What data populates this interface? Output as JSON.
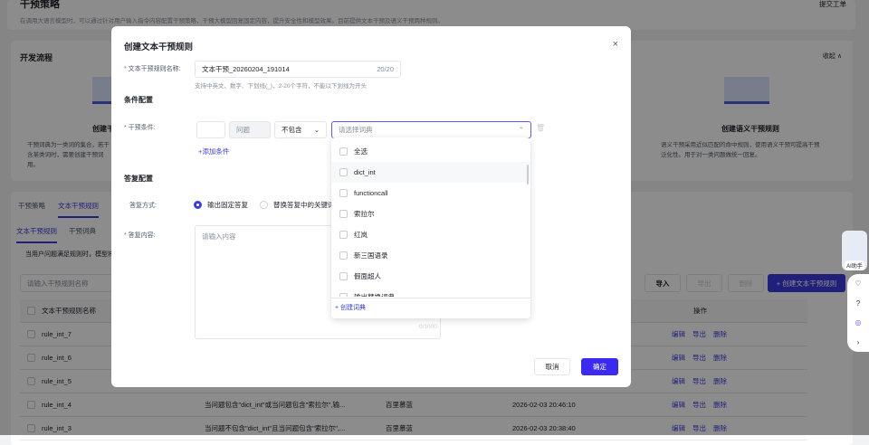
{
  "page": {
    "title": "干预策略",
    "ticket": "提交工单",
    "description": "在调用大语言模型时，可以通过针对用户输入指令内容配置干预策略，干预大模型回复固定内容，提升安全性和模型效果。目前提供文本干预及语义干预两种规则。"
  },
  "flow": {
    "title": "开发流程",
    "collapse": "收起 ∧",
    "left_title": "创建干",
    "left_desc": "干预词典为一类词的集合，若干",
    "left_desc2": "含某类词时，需要创建干预词",
    "left_desc3": "用。",
    "right_title": "创建语义干预规则",
    "right_desc": "语义干预采用近似匹配的命中规则，使用语义干预可提高干预",
    "right_desc2": "泛化性。用于对一类问题做统一回复。"
  },
  "tabs": [
    "干预策略",
    "文本干预规则"
  ],
  "subtabs": [
    "文本干预规则",
    "干预词典"
  ],
  "hint": "当用户问题满足规则时，模型将",
  "toolbar": {
    "search_placeholder": "请输入干预规则名称",
    "import": "导入",
    "export": "导出",
    "delete": "删除",
    "create": "+ 创建文本干预规则"
  },
  "table": {
    "headers": {
      "name": "文本干预规则名称",
      "ops": "操作"
    },
    "rows": [
      {
        "name": "rule_int_7",
        "cond": "",
        "creator": "",
        "time": ""
      },
      {
        "name": "rule_int_6",
        "cond": "",
        "creator": "",
        "time": ""
      },
      {
        "name": "rule_int_5",
        "cond": "",
        "creator": "",
        "time": ""
      },
      {
        "name": "rule_int_4",
        "cond": "当问题包含\"dict_int\"或当问题包含\"索拉尔\",输...",
        "creator": "百里慕蓝",
        "time": "2026-02-03 20:46:10"
      },
      {
        "name": "rule_int_3",
        "cond": "当问题不包含\"dict_int\"且当问题包含\"索拉尔\",...",
        "creator": "百里慕蓝",
        "time": "2026-02-03 20:38:40"
      }
    ],
    "ops": [
      "编辑",
      "导出",
      "删除"
    ]
  },
  "modal": {
    "title": "创建文本干预规则",
    "name_label": "文本干预规则名称:",
    "name_value": "文本干预_20260204_191014",
    "name_count": "20/20",
    "name_help": "支持中英文、数字、下划线(_)，2-20个字符，不能以下划线为开头",
    "cond_section": "条件配置",
    "cond_label": "干预条件:",
    "cond_field": "问题",
    "cond_op": "不包含",
    "dict_placeholder": "请选择词典",
    "add_cond": "+添加条件",
    "reply_section": "答复配置",
    "reply_mode_label": "答复方式:",
    "reply_mode_1": "输出固定答复",
    "reply_mode_2": "替换答复中的关键词",
    "reply_content_label": "答复内容:",
    "reply_placeholder": "请输入内容",
    "reply_count": "0/1000",
    "cancel": "取消",
    "confirm": "确定"
  },
  "dropdown": {
    "options": [
      "全选",
      "dict_int",
      "functioncall",
      "索拉尔",
      "红岚",
      "新三国语录",
      "假面超人",
      "输出替换词典"
    ],
    "create": "+ 创建词典"
  },
  "side": {
    "ai": "AI助手"
  }
}
